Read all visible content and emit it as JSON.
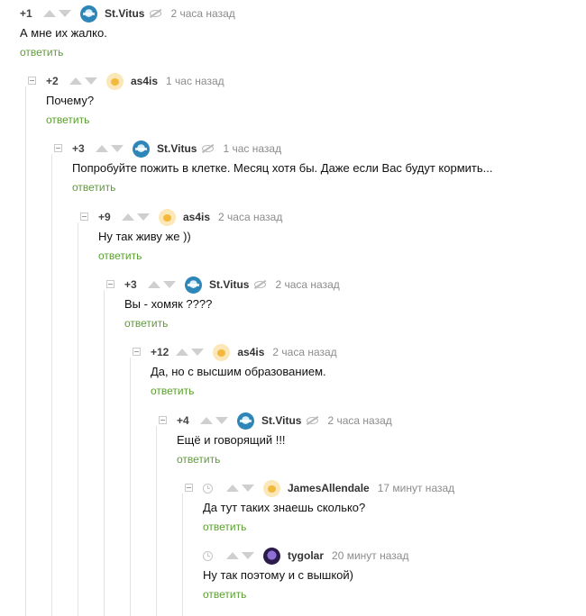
{
  "comments": [
    {
      "rating": "+1",
      "author": "St.Vitus",
      "avatar": "stvitus",
      "status_icon": "eye-off-icon",
      "time": "2 часа назад",
      "text": "А мне их жалко.",
      "reply": "ответить"
    },
    {
      "rating": "+2",
      "author": "as4is",
      "avatar": "as4is",
      "status_icon": "",
      "time": "1 час назад",
      "text": "Почему?",
      "reply": "ответить"
    },
    {
      "rating": "+3",
      "author": "St.Vitus",
      "avatar": "stvitus",
      "status_icon": "eye-off-icon",
      "time": "1 час назад",
      "text": "Попробуйте пожить в клетке.  Месяц хотя бы. Даже если Вас будут  кормить...",
      "reply": "ответить"
    },
    {
      "rating": "+9",
      "author": "as4is",
      "avatar": "as4is",
      "status_icon": "",
      "time": "2 часа назад",
      "text": "Ну так живу же ))",
      "reply": "ответить"
    },
    {
      "rating": "+3",
      "author": "St.Vitus",
      "avatar": "stvitus",
      "status_icon": "eye-off-icon",
      "time": "2 часа назад",
      "text": "Вы - хомяк  ????",
      "reply": "ответить"
    },
    {
      "rating": "+12",
      "author": "as4is",
      "avatar": "as4is",
      "status_icon": "",
      "time": "2 часа назад",
      "text": "Да, но с высшим образованием.",
      "reply": "ответить"
    },
    {
      "rating": "+4",
      "author": "St.Vitus",
      "avatar": "stvitus",
      "status_icon": "eye-off-icon",
      "time": "2 часа назад",
      "text": "Ещё и говорящий !!!",
      "reply": "ответить"
    },
    {
      "rating": "",
      "author": "JamesAllendale",
      "avatar": "james",
      "status_icon": "",
      "time": "17 минут назад",
      "text": "Да тут таких знаешь сколько?",
      "reply": "ответить"
    },
    {
      "rating": "",
      "author": "tygolar",
      "avatar": "tygolar",
      "status_icon": "",
      "time": "20 минут назад",
      "text": "Ну так поэтому и с вышкой)",
      "reply": "ответить"
    }
  ],
  "icons": {
    "vote_up": "arrow-up-icon",
    "vote_down": "arrow-down-icon",
    "collapse": "collapse-minus-icon",
    "pending_rating": "clock-icon"
  },
  "colors": {
    "reply_link": "#5c9e33",
    "time_text": "#8c8c8c",
    "thread_line": "#e3e3e3",
    "vote_arrow": "#cfcfcf"
  }
}
